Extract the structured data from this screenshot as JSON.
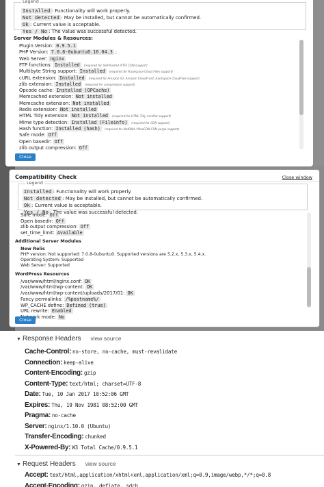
{
  "legend": {
    "title": "Legend",
    "lines": [
      {
        "code": "Installed",
        "text": ": Functionality will work properly."
      },
      {
        "code": "Not detected",
        "text": ": May be installed, but cannot be automatically confirmed."
      },
      {
        "code": "Ok",
        "text": ": Current value is acceptable."
      },
      {
        "code": "Yes / No",
        "text": ": The value was successful detected."
      }
    ]
  },
  "panel1": {
    "section_title": "Server Modules & Resources:",
    "rows": [
      {
        "label": "Plugin Version:",
        "value": "0.9.5.1",
        "note": ""
      },
      {
        "label": "PHP Version:",
        "value": "7.0.8-0ubuntu0.16.04.3",
        "note": "",
        "suffix": ";"
      },
      {
        "label": "Web Server:",
        "value": "nginx",
        "note": ""
      },
      {
        "label": "FTP functions:",
        "value": "Installed",
        "note": "(required for Self-hosted (FTP) CDN support)"
      },
      {
        "label": "Multibyte String support:",
        "value": "Installed",
        "note": "(required for Rackspace Cloud Files support)"
      },
      {
        "label": "cURL extension:",
        "value": "Installed",
        "note": "(required for Amazon S3, Amazon CloudFront, Rackspace CloudFiles support)"
      },
      {
        "label": "zlib extension:",
        "value": "Installed",
        "note": "(required for compression support)"
      },
      {
        "label": "Opcode cache:",
        "value": "Installed (OPCache)",
        "note": ""
      },
      {
        "label": "Memcached extension:",
        "value": "Not installed",
        "note": ""
      },
      {
        "label": "Memcache extension:",
        "value": "Not installed",
        "note": ""
      },
      {
        "label": "Redis extension:",
        "value": "Not installed",
        "note": ""
      },
      {
        "label": "HTML Tidy extension:",
        "value": "Not installed",
        "note": "(required for HTML Tidy minifier support)"
      },
      {
        "label": "Mime type detection:",
        "value": "Installed (Fileinfo)",
        "note": "(required for CDN support)"
      },
      {
        "label": "Hash function:",
        "value": "Installed (hash)",
        "note": "(required for NetDNA / MaxCDN CDN purge support)"
      },
      {
        "label": "Safe mode:",
        "value": "Off",
        "note": ""
      },
      {
        "label": "Open basedir:",
        "value": "Off",
        "note": ""
      },
      {
        "label": "zlib output compression:",
        "value": "Off",
        "note": ""
      }
    ],
    "close_label": "Close"
  },
  "panel2": {
    "title": "Compatibility Check",
    "close_window": "Close window",
    "rows_top": [
      {
        "label": "Safe mode:",
        "value": "Off"
      },
      {
        "label": "Open basedir:",
        "value": "Off"
      },
      {
        "label": "zlib output compression:",
        "value": "Off"
      },
      {
        "label": "set_time_limit:",
        "value": "Available"
      }
    ],
    "additional_title": "Additional Server Modules",
    "new_relic_title": "New Relic",
    "new_relic_lines": [
      "PHP version: Not supported: 7.0.8-0ubuntu0. Supported versions are 5.2.x, 5.3.x, 5.4.x.",
      "Operating System: Supported",
      "Web Server: Supported"
    ],
    "wp_title": "WordPress Resources",
    "wp_rows": [
      {
        "label": "/var/www/html/nginx.conf:",
        "value": "OK"
      },
      {
        "label": "/var/www/html/wp-content:",
        "value": "OK"
      },
      {
        "label": "/var/www/html/wp-content/uploads/2017/01:",
        "value": "OK"
      },
      {
        "label": "Fancy permalinks:",
        "value": "/%postname%/"
      },
      {
        "label": "WP_CACHE define:",
        "value": "Defined (true)"
      },
      {
        "label": "URL rewrite:",
        "value": "Enabled"
      },
      {
        "label": "Network mode:",
        "value": "No"
      }
    ],
    "close_label": "Close"
  },
  "response_headers": {
    "title": "Response Headers",
    "view_source": "view source",
    "items": [
      {
        "key": "Cache-Control:",
        "value": "no-store, no-cache, must-revalidate"
      },
      {
        "key": "Connection:",
        "value": "keep-alive"
      },
      {
        "key": "Content-Encoding:",
        "value": "gzip"
      },
      {
        "key": "Content-Type:",
        "value": "text/html; charset=UTF-8"
      },
      {
        "key": "Date:",
        "value": "Tue, 10 Jan 2017 10:52:06 GMT"
      },
      {
        "key": "Expires:",
        "value": "Thu, 19 Nov 1981 08:52:00 GMT"
      },
      {
        "key": "Pragma:",
        "value": "no-cache"
      },
      {
        "key": "Server:",
        "value": "nginx/1.10.0 (Ubuntu)"
      },
      {
        "key": "Transfer-Encoding:",
        "value": "chunked"
      },
      {
        "key": "X-Powered-By:",
        "value": "W3 Total Cache/0.9.5.1"
      }
    ]
  },
  "request_headers": {
    "title": "Request Headers",
    "view_source": "view source",
    "items": [
      {
        "key": "Accept:",
        "value": "text/html,application/xhtml+xml,application/xml;q=0.9,image/webp,*/*;q=0.8"
      },
      {
        "key": "Accept-Encoding:",
        "value": "gzip, deflate, sdch"
      }
    ]
  },
  "colors": {
    "accent": "#2a7fc7",
    "overlay": "#5c5c5c"
  }
}
